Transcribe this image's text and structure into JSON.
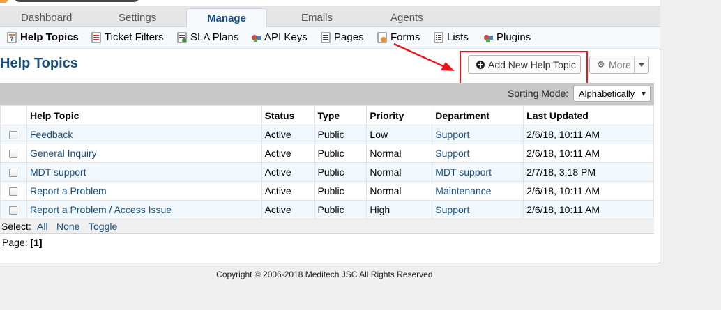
{
  "tabs": [
    "Dashboard",
    "Settings",
    "Manage",
    "Emails",
    "Agents"
  ],
  "subnav": [
    "Help Topics",
    "Ticket Filters",
    "SLA Plans",
    "API Keys",
    "Pages",
    "Forms",
    "Lists",
    "Plugins"
  ],
  "page_title": "Help Topics",
  "buttons": {
    "add": "Add New Help Topic",
    "more": "More"
  },
  "sorting": {
    "label": "Sorting Mode:",
    "value": "Alphabetically"
  },
  "table": {
    "headers": [
      "Help Topic",
      "Status",
      "Type",
      "Priority",
      "Department",
      "Last Updated"
    ],
    "rows": [
      [
        "Feedback",
        "Active",
        "Public",
        "Low",
        "Support",
        "2/6/18, 10:11 AM"
      ],
      [
        "General Inquiry",
        "Active",
        "Public",
        "Normal",
        "Support",
        "2/6/18, 10:11 AM"
      ],
      [
        "MDT support",
        "Active",
        "Public",
        "Normal",
        "MDT support",
        "2/7/18, 3:18 PM"
      ],
      [
        "Report a Problem",
        "Active",
        "Public",
        "Normal",
        "Maintenance",
        "2/6/18, 10:11 AM"
      ],
      [
        "Report a Problem / Access Issue",
        "Active",
        "Public",
        "High",
        "Support",
        "2/6/18, 10:11 AM"
      ]
    ]
  },
  "select": {
    "label": "Select:",
    "all": "All",
    "none": "None",
    "toggle": "Toggle"
  },
  "pager": {
    "label": "Page:",
    "current": "[1]"
  },
  "copyright": "Copyright © 2006-2018 Meditech JSC All Rights Reserved.",
  "colors": {
    "link": "#184e81",
    "highlight": "#e8161a",
    "row_alt": "#f0f7fd"
  }
}
